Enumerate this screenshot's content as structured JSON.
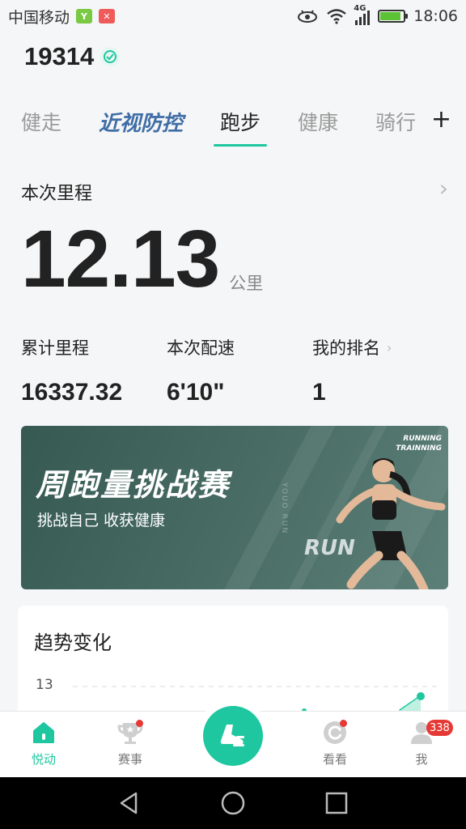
{
  "status_bar": {
    "carrier": "中国移动",
    "network": "4G",
    "time": "18:06",
    "battery_level": 0.9,
    "colors": {
      "sim_green": "#7ac943",
      "sim_red": "#ef5b5b",
      "battery": "#5bc236"
    }
  },
  "header": {
    "user_id": "19314",
    "verify_icon": "verified-badge-icon"
  },
  "tabs": [
    {
      "label": "健走"
    },
    {
      "label": "近视防控"
    },
    {
      "label": "跑步"
    },
    {
      "label": "健康"
    },
    {
      "label": "骑行"
    }
  ],
  "tabs_add": "+",
  "active_tab": "跑步",
  "summary": {
    "label": "本次里程",
    "distance": "12.13",
    "unit": "公里",
    "stats": [
      {
        "label": "累计里程",
        "value": "16337.32"
      },
      {
        "label": "本次配速",
        "value": "6'10\""
      },
      {
        "label": "我的排名",
        "value": "1"
      }
    ]
  },
  "banner": {
    "title": "周跑量挑战赛",
    "subtitle": "挑战自己 收获健康",
    "tag_line1": "RUNNING",
    "tag_line2": "TRAINNING",
    "run_text": "RUN",
    "vertical_text": "YOUO RUN"
  },
  "trend": {
    "title": "趋势变化",
    "y_label": "13"
  },
  "bottom_nav": {
    "items": [
      {
        "label": "悦动",
        "icon": "home-icon"
      },
      {
        "label": "赛事",
        "icon": "trophy-icon"
      },
      {
        "label": "看看",
        "icon": "refresh-icon"
      },
      {
        "label": "我",
        "icon": "user-icon"
      }
    ],
    "me_badge": "338",
    "center_icon": "running-shoe-icon",
    "accent": "#1fc7a0"
  }
}
